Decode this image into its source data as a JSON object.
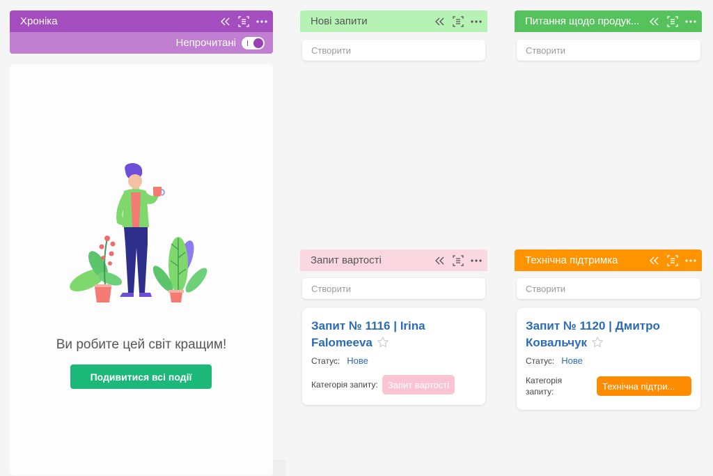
{
  "timeline": {
    "title": "Хроніка",
    "unread_label": "Непрочитані",
    "unread_on": true,
    "empty_message": "Ви робите цей світ кращим!",
    "cta_label": "Подивитися всі події",
    "header_color": "#a44dbf",
    "sub_color": "#c07fd1"
  },
  "columns": [
    {
      "title": "Нові запити",
      "color": "#b7f2b5",
      "create_placeholder": "Створити",
      "cards": []
    },
    {
      "title": "Питання щодо продук...",
      "color": "#56c25c",
      "create_placeholder": "Створити",
      "cards": []
    },
    {
      "title": "Запит вартості",
      "color": "#fbd7e1",
      "create_placeholder": "Створити",
      "cards": [
        {
          "title": "Запит № 1116 | Irina Falomeeva",
          "status_label": "Статус:",
          "status_value": "Нове",
          "category_label": "Категорія запиту:",
          "category_value": "Запит вартості",
          "category_color": "#fbc4d3"
        }
      ]
    },
    {
      "title": "Технічна підтримка",
      "color": "#ff9300",
      "create_placeholder": "Створити",
      "cards": [
        {
          "title": "Запит № 1120 | Дмитро Ковальчук",
          "status_label": "Статус:",
          "status_value": "Нове",
          "category_label": "Категорія запиту:",
          "category_value": "Технічна підтри...",
          "category_color": "#ff8c00"
        }
      ]
    }
  ],
  "icons": [
    "collapse-icon",
    "select-icon",
    "more-icon",
    "star-icon"
  ]
}
